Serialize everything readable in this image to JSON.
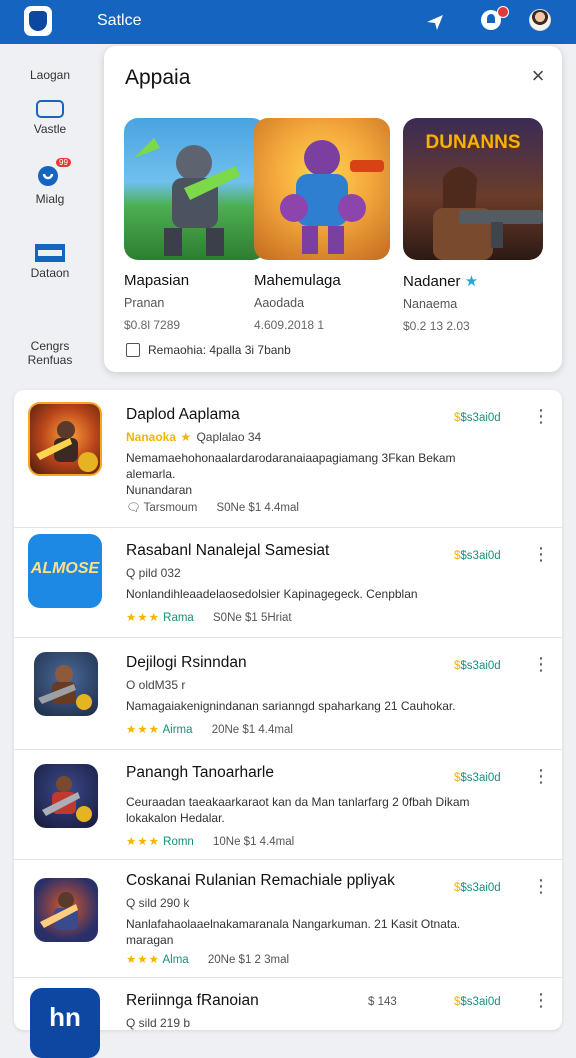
{
  "topbar": {
    "title": "Satlce"
  },
  "sidebar": {
    "items": [
      {
        "label": "Laogan"
      },
      {
        "label": "Vastle"
      },
      {
        "label": "Mialg",
        "badge": "99"
      },
      {
        "label": "Dataon"
      },
      {
        "label": "Cengrs\nRenfuas"
      }
    ]
  },
  "modal": {
    "title": "Appaia",
    "tiles": [
      {
        "name": "Mapasian",
        "sub": "Pranan",
        "stat": "$0.8l 7289"
      },
      {
        "name": "Mahemulaga",
        "sub": "Aaodada",
        "stat": "4.609.2018 1"
      },
      {
        "name": "Nadaner",
        "sub": "Nanaema",
        "stat": "$0.2 13 2.03",
        "banner": "DUNANNS"
      }
    ],
    "footer_text": "Remaohia: 4palla 3i 7banb"
  },
  "list": {
    "rows": [
      {
        "title": "Daplod Aaplama",
        "meta_tag": "Nanaoka",
        "meta": "Qaplalao 34",
        "desc": "Nemamaehohonaalardarodaranaiaapagiamang 3Fkan Bekam alemarla.",
        "desc2": "Nunandaran",
        "foot": "Tarsmoum",
        "foot2": "S0Ne $1 4.4mal",
        "price": "$s3ai0d"
      },
      {
        "title": "Rasabanl Nanalejal Samesiat",
        "meta": "Q pild 032",
        "desc": "Nonlandihleaadelaosedolsier Kapinagegeck. Cenpblan",
        "stars": "★★★",
        "rate": "Rama",
        "foot2": "S0Ne $1 5Hriat",
        "price": "$s3ai0d",
        "icon_text": "ALMOSE"
      },
      {
        "title": "Dejilogi Rsinndan",
        "meta": "O oldM35 r",
        "desc": "Namagaiakenignindanan sarianngd spaharkang 21 Cauhokar.",
        "stars": "★★★",
        "rate": "Airma",
        "foot2": "20Ne $1 4.4mal",
        "price": "$s3ai0d"
      },
      {
        "title": "Panangh Tanoarharle",
        "desc": "Ceuraadan taeakaarkaraot kan da Man tanlarfarg 2 0fbah Dikam lokakalon Hedalar.",
        "stars": "★★★",
        "rate": "Romn",
        "foot2": "10Ne $1 4.4mal",
        "price": "$s3ai0d"
      },
      {
        "title": "Coskanai Rulanian Remachiale ppliyak",
        "meta": "Q sild 290 k",
        "desc": "Nanlafahaolaaelnakamaranala Nangarkuman. 21 Kasit Otnata.",
        "desc2": "maragan",
        "stars": "★★★",
        "rate": "Alma",
        "foot2": "20Ne $1 2 3mal",
        "price": "$s3ai0d"
      },
      {
        "title": "Reriinnga fRanoian",
        "meta": "Q sild 219 b",
        "price_left": "$ 143",
        "price": "$s3ai0d",
        "icon_text": "hn"
      }
    ]
  }
}
